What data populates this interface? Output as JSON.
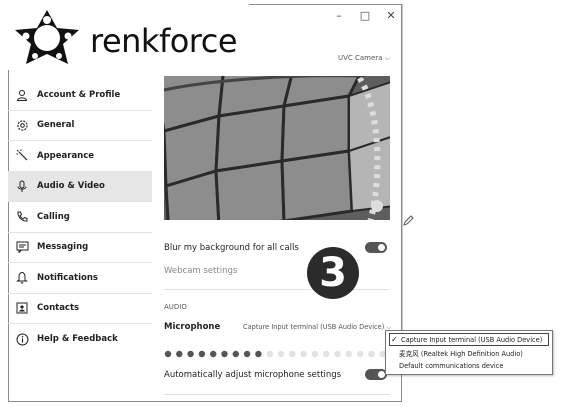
{
  "brand": {
    "name": "renkforce"
  },
  "window": {
    "controls": [
      "–",
      "□",
      "✕"
    ]
  },
  "sidebar": {
    "items": [
      {
        "label": "Account & Profile",
        "icon": "person-icon"
      },
      {
        "label": "General",
        "icon": "gear-icon"
      },
      {
        "label": "Appearance",
        "icon": "wand-icon"
      },
      {
        "label": "Audio & Video",
        "icon": "microphone-icon",
        "active": true
      },
      {
        "label": "Calling",
        "icon": "phone-icon"
      },
      {
        "label": "Messaging",
        "icon": "chat-icon"
      },
      {
        "label": "Notifications",
        "icon": "bell-icon"
      },
      {
        "label": "Contacts",
        "icon": "contacts-icon"
      },
      {
        "label": "Help & Feedback",
        "icon": "info-icon"
      }
    ]
  },
  "video": {
    "camera_select": "UVC Camera",
    "blur_label": "Blur my background for all calls",
    "webcam_settings": "Webcam settings"
  },
  "audio": {
    "section_title": "AUDIO",
    "mic_label": "Microphone",
    "mic_selected": "Capture Input terminal (USB Audio Device)",
    "auto_adjust_label": "Automatically adjust microphone settings",
    "level_active_dots": 9,
    "level_total_dots": 20
  },
  "dropdown": {
    "options": [
      {
        "label": "Capture Input terminal (USB Audio Device)",
        "selected": true
      },
      {
        "label": "麦克风 (Realtek High Definition Audio)",
        "selected": false
      },
      {
        "label": "Default communications device",
        "selected": false
      }
    ]
  },
  "step_badge": "3",
  "colors": {
    "active_bg": "#e6e6e6",
    "toggle_on": "#555555"
  }
}
